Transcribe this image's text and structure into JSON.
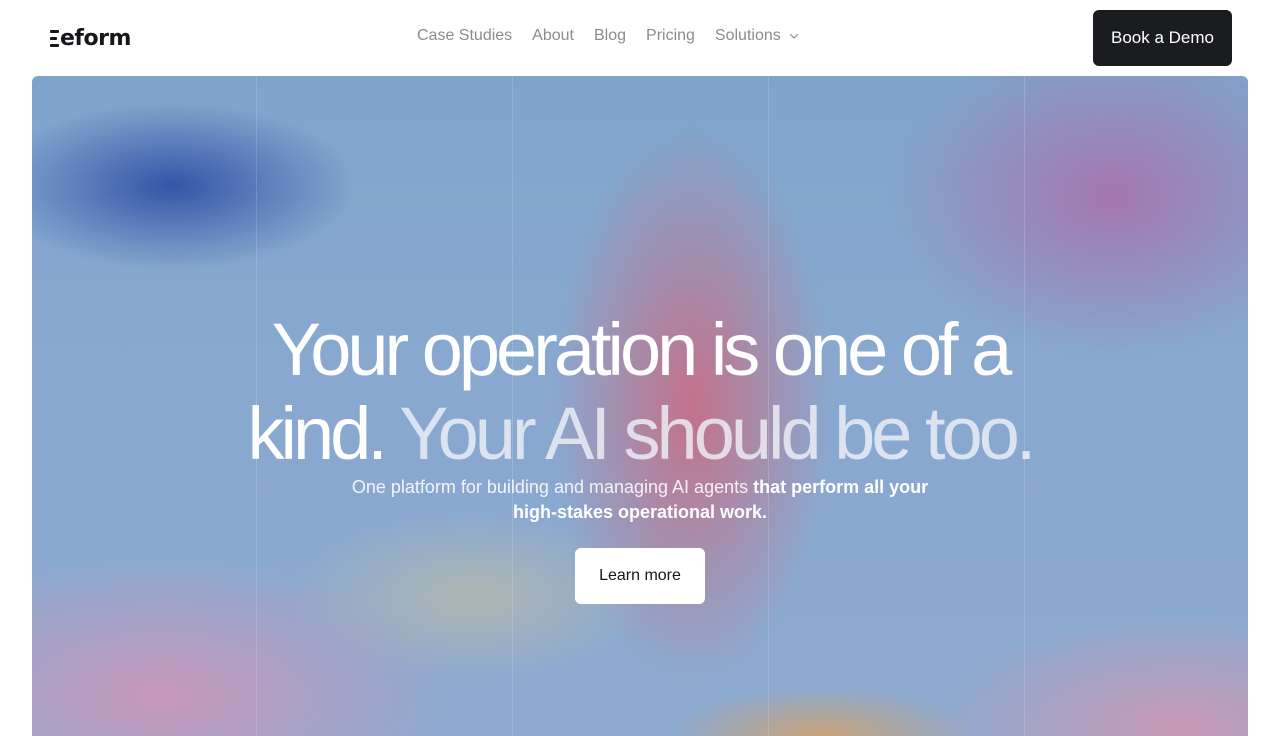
{
  "header": {
    "logo_text": "eform",
    "logo_icon": "stacked-bars-logo-mark",
    "nav": [
      {
        "label": "Case Studies"
      },
      {
        "label": "About"
      },
      {
        "label": "Blog"
      },
      {
        "label": "Pricing"
      },
      {
        "label": "Solutions",
        "icon": "chevron-down-icon"
      }
    ],
    "cta_label": "Book a Demo"
  },
  "hero": {
    "headline_line1": "Your operation is one of a",
    "headline_line2_start": "kind.",
    "headline_line2_end": "Your AI should be too.",
    "subtitle_plain": "One platform for building and managing AI agents",
    "subtitle_bold": "that perform all your high-stakes operational work.",
    "button_label": "Learn more"
  },
  "colors": {
    "text_dark": "#16171a",
    "nav_gray": "#8a8c91",
    "cta_background": "#1b1c20",
    "hero_base": "#88a8cf",
    "white": "#ffffff"
  }
}
